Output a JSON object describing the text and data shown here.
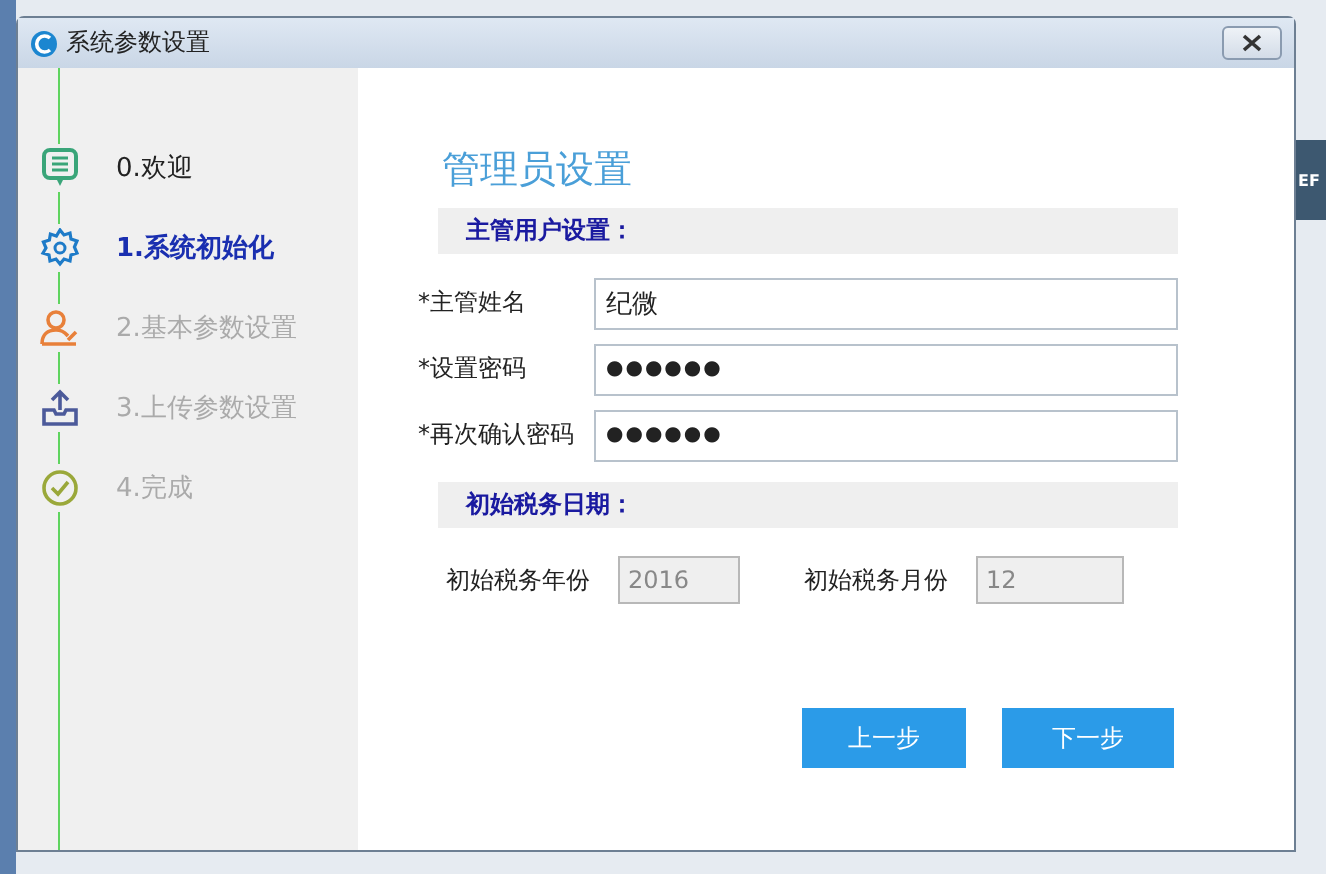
{
  "background": {
    "fragment": "EF"
  },
  "window": {
    "title": "系统参数设置"
  },
  "steps": [
    {
      "label": "0.欢迎",
      "selected": false,
      "disabled": false
    },
    {
      "label": "1.系统初始化",
      "selected": true,
      "disabled": false
    },
    {
      "label": "2.基本参数设置",
      "selected": false,
      "disabled": true
    },
    {
      "label": "3.上传参数设置",
      "selected": false,
      "disabled": true
    },
    {
      "label": "4.完成",
      "selected": false,
      "disabled": true
    }
  ],
  "heading": "管理员设置",
  "admin_section": {
    "title": "主管用户设置：",
    "fields": [
      {
        "label": "*主管姓名",
        "value": "纪微",
        "kind": "text"
      },
      {
        "label": "*设置密码",
        "value": "●●●●●●",
        "kind": "password"
      },
      {
        "label": "*再次确认密码",
        "value": "●●●●●●",
        "kind": "password"
      }
    ]
  },
  "tax_section": {
    "title": "初始税务日期：",
    "fields": [
      {
        "label": "初始税务年份",
        "value": "2016",
        "disabled": true
      },
      {
        "label": "初始税务月份",
        "value": "12",
        "disabled": true
      }
    ]
  },
  "buttons": [
    "上一步",
    "下一步"
  ]
}
